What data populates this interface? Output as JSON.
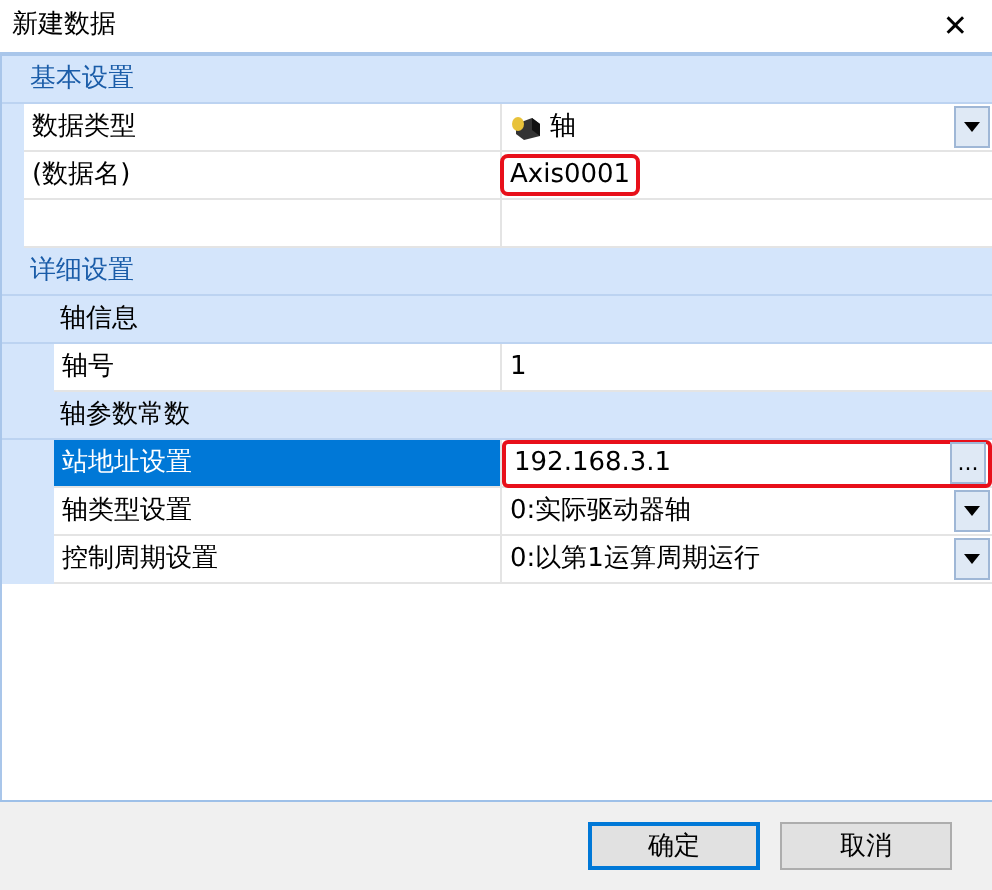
{
  "window": {
    "title": "新建数据",
    "close": "✕"
  },
  "properties": [
    {
      "label": "基本设置",
      "children": [
        {
          "label": "数据类型",
          "value": "轴",
          "kind": "dropdown",
          "selected": false,
          "highlighted": false
        },
        {
          "label": "(数据名)",
          "value": "Axis0001",
          "kind": "text",
          "selected": false,
          "highlighted": true
        },
        {
          "kind": "blank"
        }
      ]
    },
    {
      "label": "详细设置",
      "children": [
        {
          "label": "轴信息",
          "children": [
            {
              "label": "轴号",
              "value": "1",
              "kind": "text",
              "selected": false,
              "highlighted": false
            }
          ]
        },
        {
          "label": "轴参数常数",
          "children": [
            {
              "label": "站地址设置",
              "value": "192.168.3.1",
              "kind": "ellipsis",
              "button": "...",
              "selected": true,
              "highlighted": true
            },
            {
              "label": "轴类型设置",
              "value": "0:实际驱动器轴",
              "kind": "dropdown",
              "selected": false,
              "highlighted": false
            },
            {
              "label": "控制周期设置",
              "value": "0:以第1运算周期运行",
              "kind": "dropdown",
              "selected": false,
              "highlighted": false
            }
          ]
        }
      ]
    }
  ],
  "buttons": [
    {
      "label": "确定",
      "default": true
    },
    {
      "label": "取消",
      "default": false
    }
  ]
}
